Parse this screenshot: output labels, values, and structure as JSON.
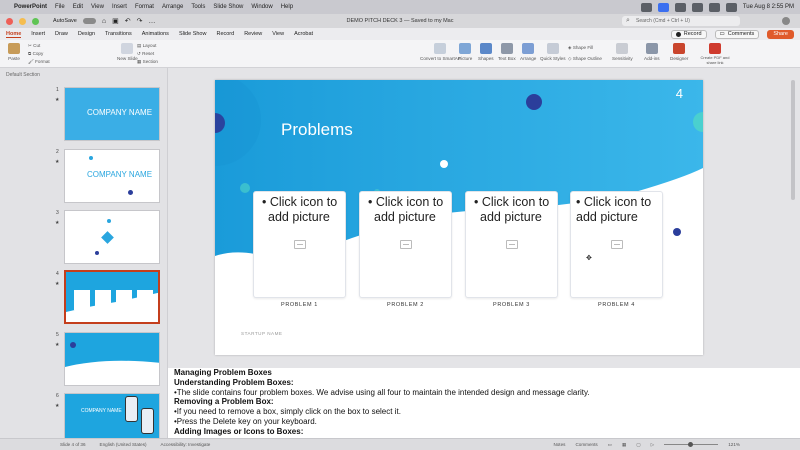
{
  "menubar": {
    "app_name": "PowerPoint",
    "items": [
      "File",
      "Edit",
      "View",
      "Insert",
      "Format",
      "Arrange",
      "Tools",
      "Slide Show",
      "Window",
      "Help"
    ],
    "clock": "Tue Aug 8  2:55 PM"
  },
  "titlebar": {
    "autosave_label": "AutoSave",
    "doc_title": "DEMO PITCH DECK 3 — Saved to my Mac",
    "search_placeholder": "Search (Cmd + Ctrl + U)"
  },
  "tabs": {
    "items": [
      "Home",
      "Insert",
      "Draw",
      "Design",
      "Transitions",
      "Animations",
      "Slide Show",
      "Record",
      "Review",
      "View",
      "Acrobat"
    ],
    "active": "Home",
    "record": "Record",
    "comments": "Comments",
    "share": "Share"
  },
  "ribbon": {
    "paste": "Paste",
    "cut": "Cut",
    "copy": "Copy",
    "format": "Format",
    "new_slide": "New Slide",
    "layout": "Layout",
    "reset": "Reset",
    "section": "Section",
    "convert": "Convert to SmartArt",
    "picture": "Picture",
    "shapes": "Shapes",
    "text_box": "Text Box",
    "arrange": "Arrange",
    "quick_styles": "Quick Styles",
    "shape_fill": "Shape Fill",
    "shape_outline": "Shape Outline",
    "sensitivity": "Sensitivity",
    "addins": "Add-ins",
    "designer": "Designer",
    "create_pdf": "Create PDF and share link"
  },
  "sidebar": {
    "section_label": "Default Section",
    "thumbs": [
      {
        "num": "1",
        "text": "COMPANY NAME"
      },
      {
        "num": "2",
        "text": "COMPANY NAME"
      },
      {
        "num": "3",
        "text": ""
      },
      {
        "num": "4",
        "text": ""
      },
      {
        "num": "5",
        "text": ""
      },
      {
        "num": "6",
        "text": "COMPANY NAME"
      }
    ]
  },
  "slide": {
    "number": "4",
    "title": "Problems",
    "cards": [
      {
        "placeholder": "Click icon to add picture",
        "label": "PROBLEM 1"
      },
      {
        "placeholder": "Click icon to add picture",
        "label": "PROBLEM 2"
      },
      {
        "placeholder": "Click icon to add picture",
        "label": "PROBLEM 3"
      },
      {
        "placeholder": "Click icon to add picture",
        "label": "PROBLEM 4"
      }
    ],
    "footer": "STARTUP NAME",
    "colors": {
      "accent": "#1ea5df",
      "dark_dot": "#2b3e9b",
      "teal": "#4fd6c8"
    }
  },
  "notes": {
    "h1": "Managing Problem Boxes",
    "h2": "Understanding Problem Boxes:",
    "p1": "•The slide contains four problem boxes. We advise using all four to maintain the intended design and message clarity.",
    "h3": "Removing a Problem Box:",
    "p2": "•If you need to remove a box, simply click on the box to select it.",
    "p3": "•Press the Delete key on your keyboard.",
    "h4": "Adding Images or Icons to Boxes:"
  },
  "statusbar": {
    "slide_of": "Slide 4 of 36",
    "language": "English (United States)",
    "accessibility": "Accessibility: Investigate",
    "notes": "Notes",
    "comments": "Comments",
    "zoom": "121%"
  }
}
